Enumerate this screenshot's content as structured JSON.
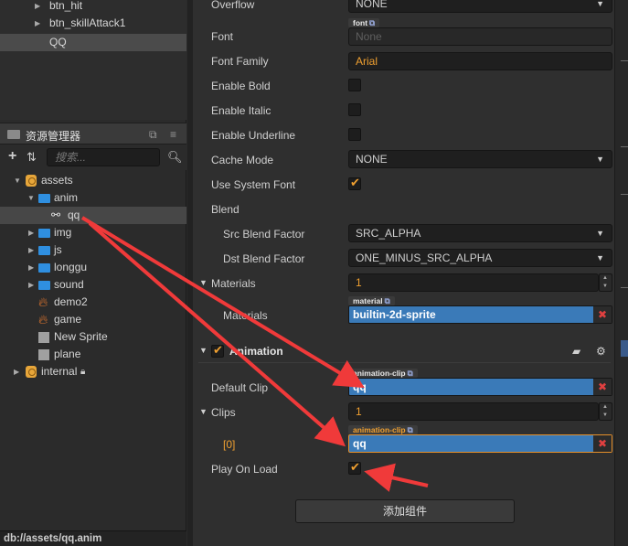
{
  "hierarchy": {
    "items": [
      {
        "label": "btn_hit"
      },
      {
        "label": "btn_skillAttack1"
      },
      {
        "label": "QQ"
      }
    ]
  },
  "assets_panel": {
    "title": "资源管理器",
    "search_placeholder": "搜索...",
    "tree": [
      {
        "label": "assets",
        "icon": "database-icon"
      },
      {
        "label": "anim",
        "icon": "folder-icon"
      },
      {
        "label": "qq",
        "icon": "animation-clip-icon"
      },
      {
        "label": "img",
        "icon": "folder-icon"
      },
      {
        "label": "js",
        "icon": "folder-icon"
      },
      {
        "label": "longgu",
        "icon": "folder-icon"
      },
      {
        "label": "sound",
        "icon": "folder-icon"
      },
      {
        "label": "demo2",
        "icon": "fire-icon"
      },
      {
        "label": "game",
        "icon": "fire-icon"
      },
      {
        "label": "New Sprite",
        "icon": "prefab-icon"
      },
      {
        "label": "plane",
        "icon": "prefab-icon"
      },
      {
        "label": "internal",
        "icon": "database-icon"
      }
    ],
    "footer_path": "db://assets/qq.anim"
  },
  "label_props": {
    "overflow": {
      "label": "Overflow",
      "value": "NONE"
    },
    "font": {
      "label": "Font",
      "tag": "font",
      "value": "None"
    },
    "font_family": {
      "label": "Font Family",
      "value": "Arial"
    },
    "enable_bold": {
      "label": "Enable Bold",
      "checked": false
    },
    "enable_italic": {
      "label": "Enable Italic",
      "checked": false
    },
    "enable_underline": {
      "label": "Enable Underline",
      "checked": false
    },
    "cache_mode": {
      "label": "Cache Mode",
      "value": "NONE"
    },
    "use_system_font": {
      "label": "Use System Font",
      "checked": true
    },
    "blend": {
      "label": "Blend"
    },
    "src_blend": {
      "label": "Src Blend Factor",
      "value": "SRC_ALPHA"
    },
    "dst_blend": {
      "label": "Dst Blend Factor",
      "value": "ONE_MINUS_SRC_ALPHA"
    },
    "materials": {
      "label": "Materials",
      "count": "1"
    },
    "materials_item": {
      "label": "Materials",
      "tag": "material",
      "value": "builtin-2d-sprite"
    }
  },
  "animation": {
    "title": "Animation",
    "enabled": true,
    "default_clip": {
      "label": "Default Clip",
      "tag": "animation-clip",
      "value": "qq"
    },
    "clips": {
      "label": "Clips",
      "count": "1"
    },
    "clip0": {
      "label": "[0]",
      "tag": "animation-clip",
      "value": "qq"
    },
    "play_on_load": {
      "label": "Play On Load",
      "checked": true
    }
  },
  "add_component_label": "添加组件",
  "colors": {
    "accent": "#f0a030",
    "selection_blue": "#3a7ab8",
    "annotation_red": "#f03a3a"
  }
}
